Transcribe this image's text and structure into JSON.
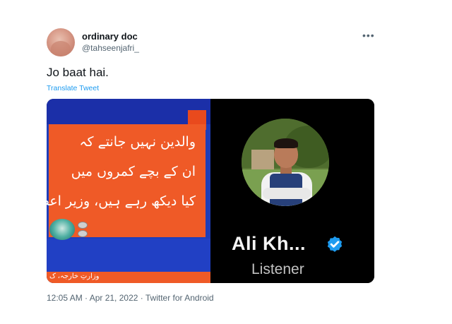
{
  "tweet": {
    "display_name": "ordinary doc",
    "handle": "@tahseenjafri_",
    "more_icon": "ellipsis-icon",
    "text": "Jo baat hai.",
    "translate_label": "Translate Tweet",
    "timestamp": "12:05 AM · Apr 21, 2022 · Twitter for Android"
  },
  "media": {
    "left_image": {
      "lines": [
        "والدین نہیں جانتے کہ",
        "ان کے بچے کمروں میں",
        "کیا دیکھ رہے ہیں، وزیر اعظم"
      ],
      "bottom_text": "وزارتِ خارجہ، ک"
    },
    "right_image": {
      "name": "Ali Kh...",
      "role": "Listener",
      "verified_color": "#1d9bf0"
    }
  },
  "colors": {
    "link": "#1d9bf0",
    "secondary_text": "#536471",
    "orange": "#ef5a27",
    "news_blue": "#1e3db8"
  }
}
